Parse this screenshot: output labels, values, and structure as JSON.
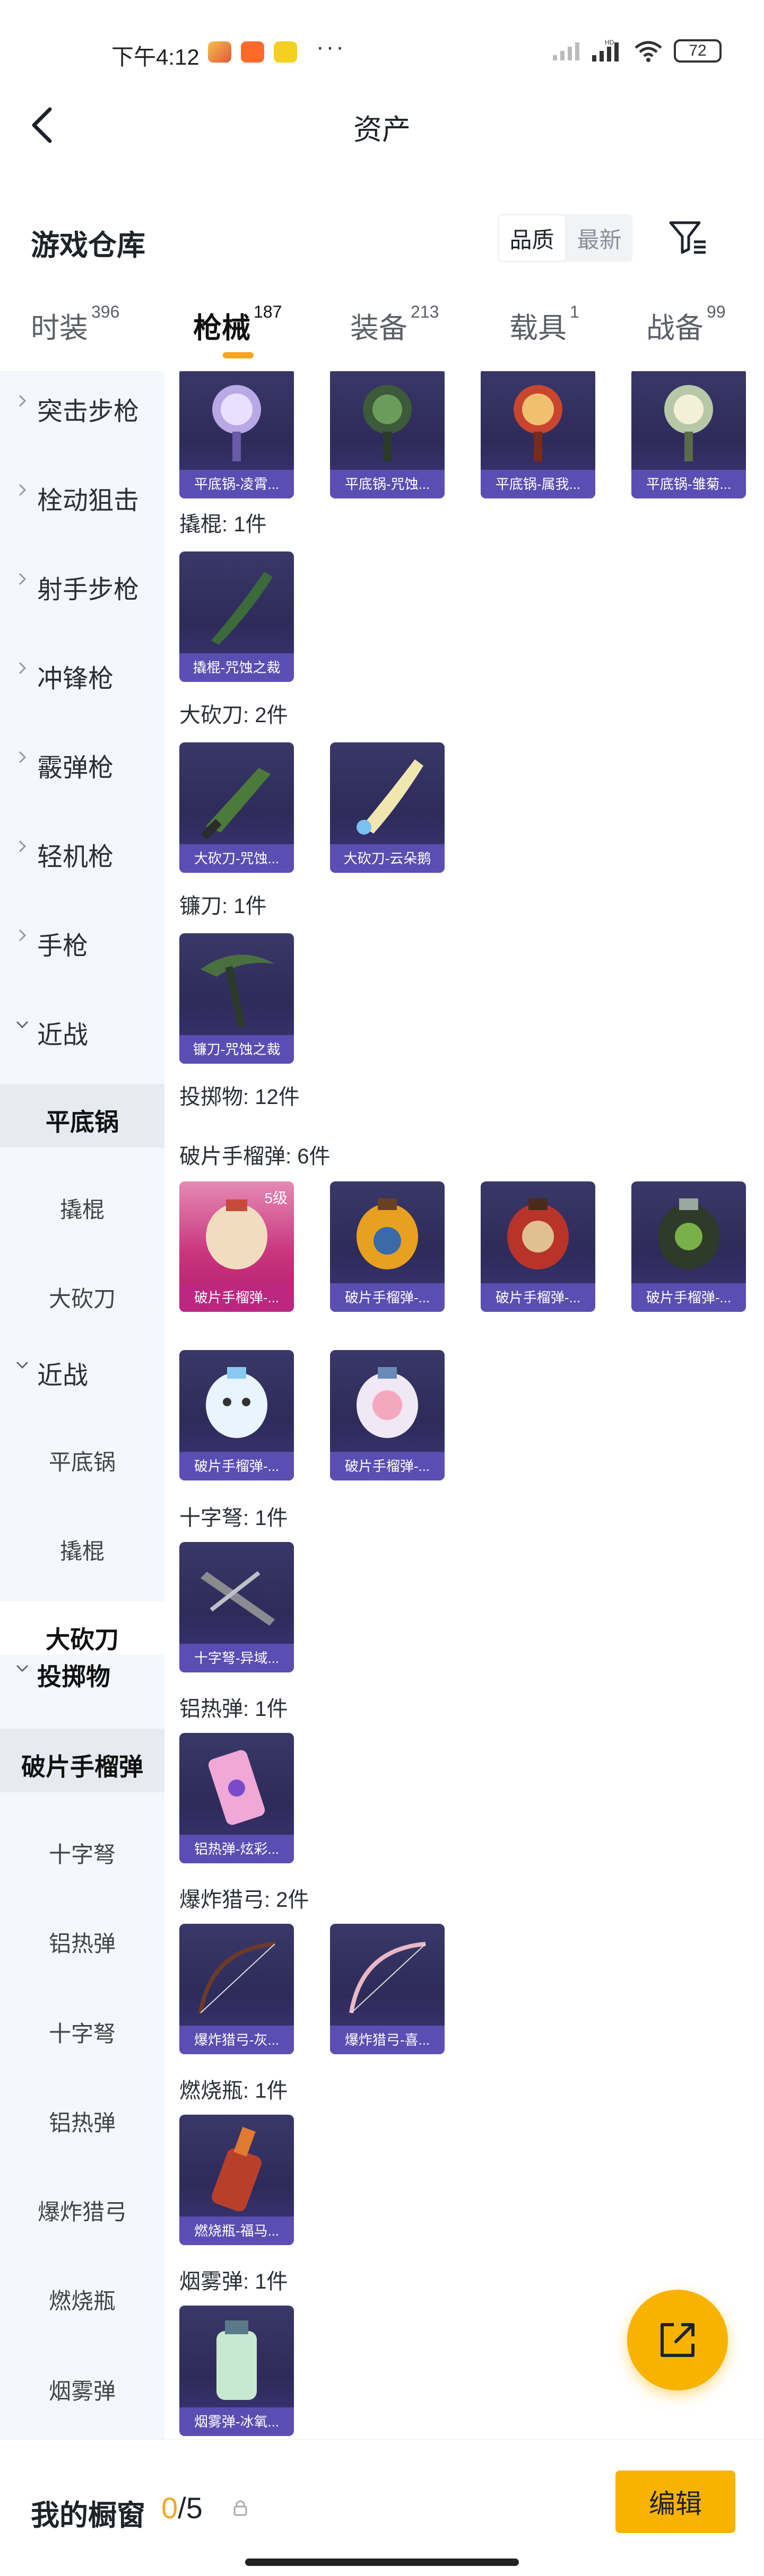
{
  "status_bar": {
    "time": "下午4:12",
    "dots": "···",
    "battery": "72",
    "app_icon_names": [
      "news-app-icon",
      "taobao-icon",
      "mini-game-icon"
    ],
    "hd_label": "HD"
  },
  "nav": {
    "title": "资产",
    "back_icon": "chevron-left-icon"
  },
  "warehouse": {
    "title": "游戏仓库",
    "sort_options": [
      "品质",
      "最新"
    ],
    "sort_selected": "品质",
    "filter_icon": "filter-icon"
  },
  "tabs": [
    {
      "label": "时装",
      "count": "396"
    },
    {
      "label": "枪械",
      "count": "187",
      "active": true
    },
    {
      "label": "装备",
      "count": "213"
    },
    {
      "label": "载具",
      "count": "1"
    },
    {
      "label": "战备",
      "count": "99"
    }
  ],
  "sidebar": {
    "items": [
      {
        "label": "突击步枪"
      },
      {
        "label": "栓动狙击"
      },
      {
        "label": "射手步枪"
      },
      {
        "label": "冲锋枪"
      },
      {
        "label": "霰弹枪"
      },
      {
        "label": "轻机枪"
      },
      {
        "label": "手枪"
      },
      {
        "label": "近战"
      },
      {
        "label": "平底锅"
      },
      {
        "label": "撬棍"
      },
      {
        "label": "大砍刀"
      },
      {
        "label": "近战"
      },
      {
        "label": "平底锅"
      },
      {
        "label": "撬棍"
      },
      {
        "label": "大砍刀"
      },
      {
        "label": "投掷物"
      },
      {
        "label": "破片手榴弹"
      },
      {
        "label": "十字弩"
      },
      {
        "label": "铝热弹"
      },
      {
        "label": "十字弩"
      },
      {
        "label": "铝热弹"
      },
      {
        "label": "爆炸猎弓"
      },
      {
        "label": "燃烧瓶"
      },
      {
        "label": "烟雾弹"
      }
    ]
  },
  "content": {
    "pan_cards": [
      "平底锅-凌霄...",
      "平底锅-咒蚀...",
      "平底锅-属我...",
      "平底锅-雏菊..."
    ],
    "crowbar_label": "撬棍: 1件",
    "crowbar_cards": [
      "撬棍-咒蚀之裁"
    ],
    "machete_label": "大砍刀: 2件",
    "machete_cards": [
      "大砍刀-咒蚀...",
      "大砍刀-云朵鹅"
    ],
    "sickle_label": "镰刀: 1件",
    "sickle_cards": [
      "镰刀-咒蚀之裁"
    ],
    "throwables_label": "投掷物: 12件",
    "frag_label": "破片手榴弹: 6件",
    "frag_cards": [
      "破片手榴弹-...",
      "破片手榴弹-...",
      "破片手榴弹-...",
      "破片手榴弹-...",
      "破片手榴弹-...",
      "破片手榴弹-..."
    ],
    "frag_level_badge": "5级",
    "crossbow_label": "十字弩: 1件",
    "crossbow_cards": [
      "十字弩-异域..."
    ],
    "thermite_label": "铝热弹: 1件",
    "thermite_cards": [
      "铝热弹-炫彩..."
    ],
    "bow_label": "爆炸猎弓: 2件",
    "bow_cards": [
      "爆炸猎弓-灰...",
      "爆炸猎弓-喜..."
    ],
    "molotov_label": "燃烧瓶: 1件",
    "molotov_cards": [
      "燃烧瓶-福马..."
    ],
    "smoke_label": "烟雾弹: 1件",
    "smoke_cards": [
      "烟雾弹-冰氧..."
    ]
  },
  "fab": {
    "icon": "share-export-icon"
  },
  "bottom": {
    "showcase_title": "我的橱窗",
    "showcase_current": "0",
    "showcase_total": "/5",
    "edit_label": "编辑"
  },
  "colors": {
    "accent": "#f8b300",
    "tab_underline": "#f5a623",
    "sidebar_bg": "#f4f7fb",
    "card_bg": "#2e2b5a",
    "card_caption_bg": "#6252be",
    "card_pink_bg": "#c9357e"
  }
}
